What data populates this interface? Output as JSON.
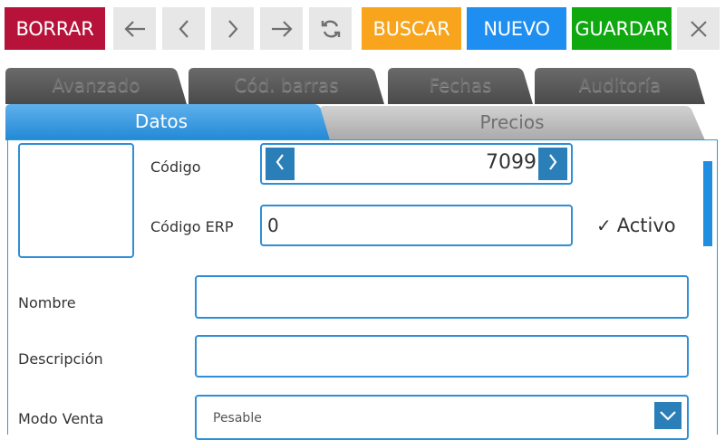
{
  "toolbar": {
    "borrar": "BORRAR",
    "buscar": "BUSCAR",
    "nuevo": "NUEVO",
    "guardar": "GUARDAR"
  },
  "colors": {
    "borrar": "#b7133a",
    "buscar": "#f8a51d",
    "nuevo": "#1e8ef0",
    "guardar": "#0fa80f",
    "accent": "#2e8fd6"
  },
  "icons": [
    "arrow-left-icon",
    "chevron-left-icon",
    "chevron-right-icon",
    "arrow-right-icon",
    "refresh-icon",
    "close-icon"
  ],
  "tabs": {
    "back": [
      "Avanzado",
      "Cód. barras",
      "Fechas",
      "Auditoría"
    ],
    "front": [
      "Datos",
      "Precios"
    ],
    "active": "Datos"
  },
  "form": {
    "codigo_label": "Código",
    "codigo_value": "7099",
    "codigo_erp_label": "Código ERP",
    "codigo_erp_value": "0",
    "activo_label": "Activo",
    "nombre_label": "Nombre",
    "nombre_value": "",
    "descripcion_label": "Descripción",
    "descripcion_value": "",
    "modo_venta_label": "Modo Venta",
    "modo_venta_value": "Pesable"
  }
}
